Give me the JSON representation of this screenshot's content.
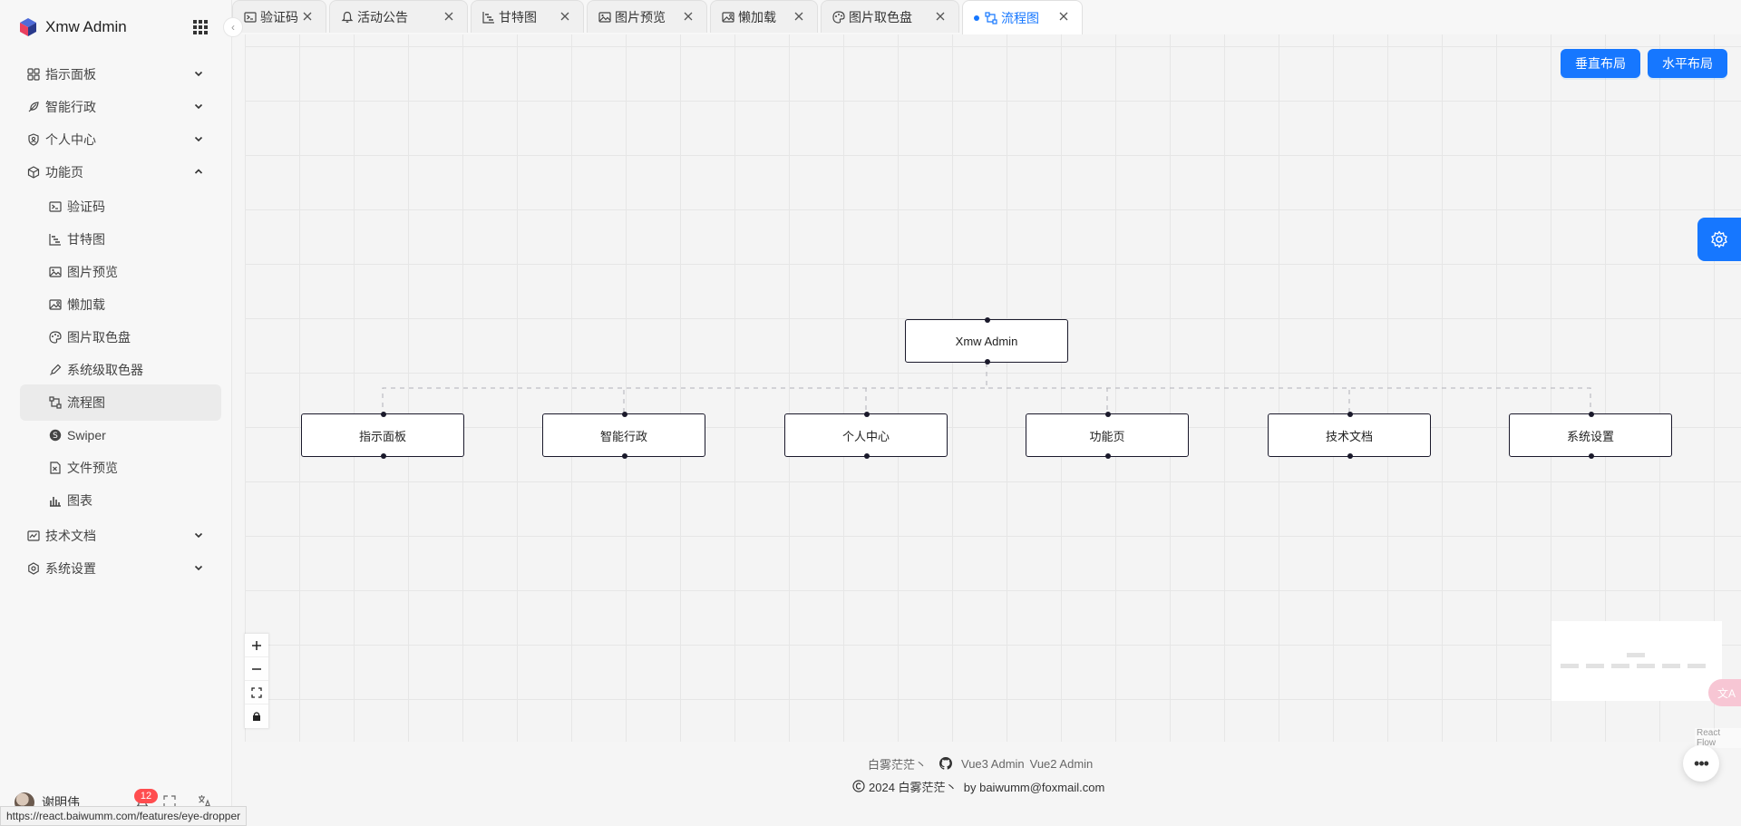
{
  "app": {
    "title": "Xmw Admin"
  },
  "colors": {
    "primary": "#1677ff",
    "badge": "#ff4d4f",
    "node_border": "#1a192b",
    "edge": "#b1b1b7"
  },
  "sidebar": {
    "menu": [
      {
        "label": "指示面板",
        "icon": "dashboard-icon",
        "expandable": true,
        "expanded": false
      },
      {
        "label": "智能行政",
        "icon": "feather-icon",
        "expandable": true,
        "expanded": false
      },
      {
        "label": "个人中心",
        "icon": "user-shield-icon",
        "expandable": true,
        "expanded": false
      },
      {
        "label": "功能页",
        "icon": "box-icon",
        "expandable": true,
        "expanded": true
      },
      {
        "label": "验证码",
        "icon": "captcha-icon",
        "sub": true
      },
      {
        "label": "甘特图",
        "icon": "gantt-icon",
        "sub": true
      },
      {
        "label": "图片预览",
        "icon": "image-icon",
        "sub": true
      },
      {
        "label": "懒加载",
        "icon": "lazy-image-icon",
        "sub": true
      },
      {
        "label": "图片取色盘",
        "icon": "palette-icon",
        "sub": true
      },
      {
        "label": "系统级取色器",
        "icon": "eyedropper-icon",
        "sub": true
      },
      {
        "label": "流程图",
        "icon": "flow-icon",
        "sub": true,
        "active": true
      },
      {
        "label": "Swiper",
        "icon": "swiper-icon",
        "sub": true
      },
      {
        "label": "文件预览",
        "icon": "file-preview-icon",
        "sub": true
      },
      {
        "label": "图表",
        "icon": "bar-chart-icon",
        "sub": true
      },
      {
        "label": "技术文档",
        "icon": "doc-icon",
        "expandable": true,
        "expanded": false
      },
      {
        "label": "系统设置",
        "icon": "settings-icon",
        "expandable": true,
        "expanded": false
      }
    ],
    "user": {
      "name": "谢明伟",
      "notifications": "12"
    }
  },
  "tabs": [
    {
      "label": "验证码",
      "icon": "captcha-icon"
    },
    {
      "label": "活动公告",
      "icon": "bell-icon"
    },
    {
      "label": "甘特图",
      "icon": "gantt-icon"
    },
    {
      "label": "图片预览",
      "icon": "image-icon"
    },
    {
      "label": "懒加载",
      "icon": "lazy-image-icon"
    },
    {
      "label": "图片取色盘",
      "icon": "palette-icon"
    },
    {
      "label": "流程图",
      "icon": "flow-icon",
      "active": true
    }
  ],
  "toolbar": {
    "vertical_label": "垂直布局",
    "horizontal_label": "水平布局"
  },
  "flow": {
    "root": "Xmw Admin",
    "children": [
      "指示面板",
      "智能行政",
      "个人中心",
      "功能页",
      "技术文档",
      "系统设置"
    ],
    "attribution": "React Flow"
  },
  "footer": {
    "author": "白雾茫茫丶",
    "link1": "Vue3 Admin",
    "link2": "Vue2 Admin",
    "copyright": "2024 白雾茫茫丶  by baiwumm@foxmail.com"
  },
  "status_url": "https://react.baiwumm.com/features/eye-dropper"
}
